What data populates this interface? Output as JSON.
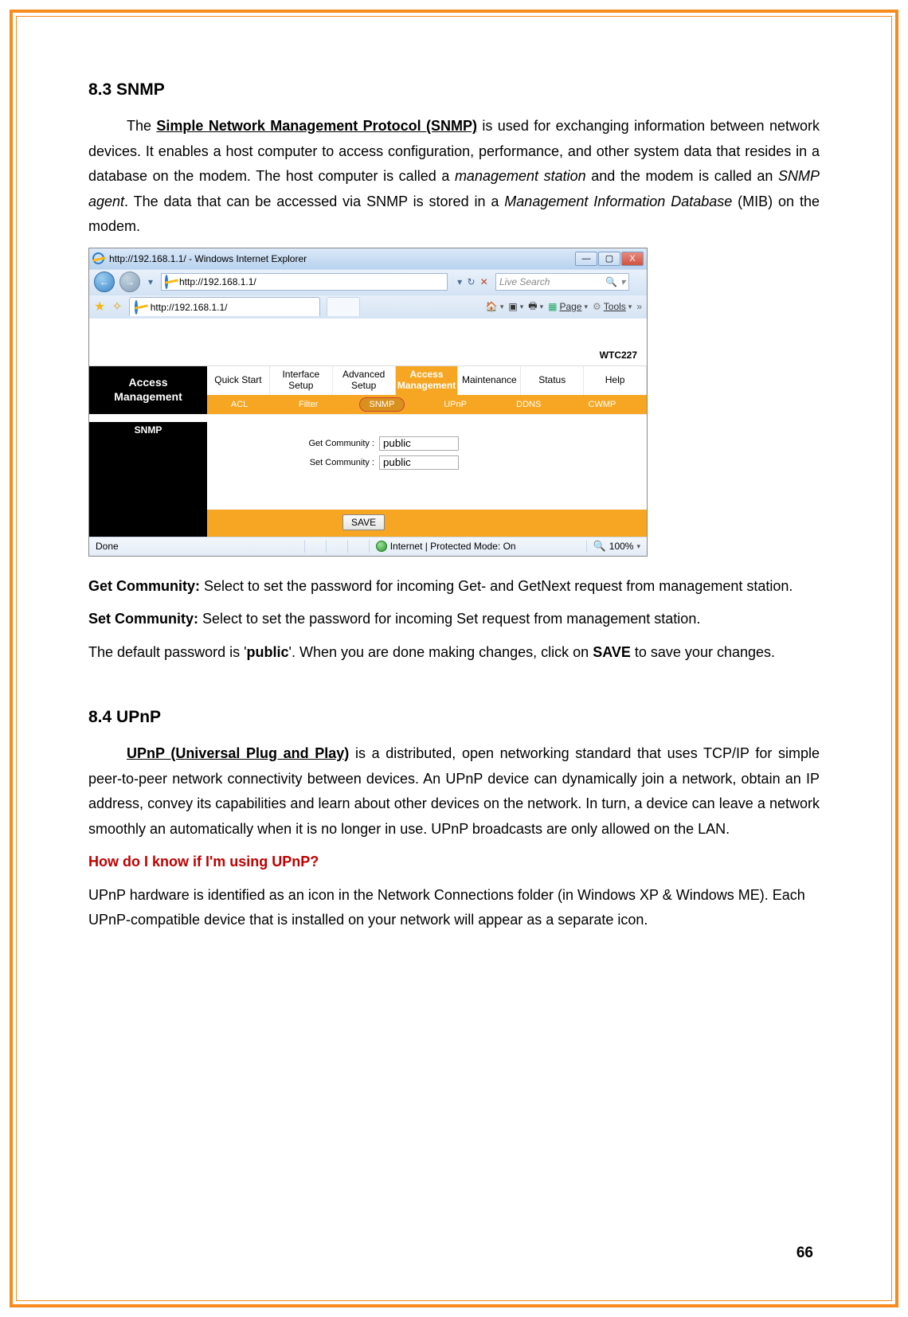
{
  "section83": {
    "heading": "8.3  SNMP",
    "para1_pre": "The ",
    "para1_snmp": "Simple Network Management Protocol (SNMP)",
    "para1_post": " is used for exchanging information between network devices. It enables a host computer to access configuration, performance, and other system data that resides in a database on the modem. The host computer is called a ",
    "para1_mgmt": "management station",
    "para1_mid": " and the modem is called an ",
    "para1_agent": "SNMP agent",
    "para1_post2": ". The data that can be accessed via SNMP is stored in a ",
    "para1_mib": "Management Information Database",
    "para1_end": " (MIB) on the modem."
  },
  "ie": {
    "title": "http://192.168.1.1/ - Windows Internet Explorer",
    "min": "—",
    "max": "▢",
    "close": "X",
    "back": "←",
    "fwd": "→",
    "dropdown": "▾",
    "url": "http://192.168.1.1/",
    "refresh": "↻",
    "stop": "✕",
    "search_placeholder": "Live Search",
    "mag": "🔍",
    "star": "★",
    "starplus": "✧",
    "tab_label": "http://192.168.1.1/",
    "home": "🏠",
    "feeds": "▣",
    "print": "🖶",
    "page": "Page",
    "tools": "Tools",
    "dblchev": "»"
  },
  "router": {
    "model": "WTC227",
    "sidebar_title_l1": "Access",
    "sidebar_title_l2": "Management",
    "main_tabs": [
      "Quick Start",
      "Interface Setup",
      "Advanced Setup",
      "Access Management",
      "Maintenance",
      "Status",
      "Help"
    ],
    "active_main": 3,
    "sub_tabs": [
      "ACL",
      "Filter",
      "SNMP",
      "UPnP",
      "DDNS",
      "CWMP"
    ],
    "active_sub": 2,
    "snmp_tag": "SNMP",
    "get_label": "Get Community :",
    "get_value": "public",
    "set_label": "Set Community :",
    "set_value": "public",
    "save": "SAVE"
  },
  "status": {
    "done": "Done",
    "mode": "Internet | Protected Mode: On",
    "zoom": "100%"
  },
  "desc": {
    "get_label": "Get Community:",
    "get_text": " Select to set the password for incoming Get- and GetNext request from management station.",
    "set_label": "Set Community:",
    "set_text": " Select to set the password for incoming Set request from management station.",
    "note_pre": "The default password is '",
    "note_word": "public",
    "note_mid": "'. When you are done making changes, click on ",
    "note_save": "SAVE",
    "note_end": " to save your changes."
  },
  "section84": {
    "heading": "8.4 UPnP",
    "para1_link": "UPnP (Universal Plug and Play)",
    "para1_rest": " is a distributed, open networking standard that uses TCP/IP for simple peer-to-peer network connectivity between devices. An UPnP device can dynamically join a network, obtain an IP address, convey its capabilities and learn about other devices on the network. In turn, a device can leave a network smoothly an automatically when it is no longer in use. UPnP broadcasts are only allowed on the LAN.",
    "q": "How do I know if I'm using UPnP?",
    "para2": "UPnP hardware is identified as an icon in the Network Connections folder (in Windows XP & Windows ME). Each UPnP-compatible device that is installed on your network will appear as a separate icon."
  },
  "page_number": "66"
}
